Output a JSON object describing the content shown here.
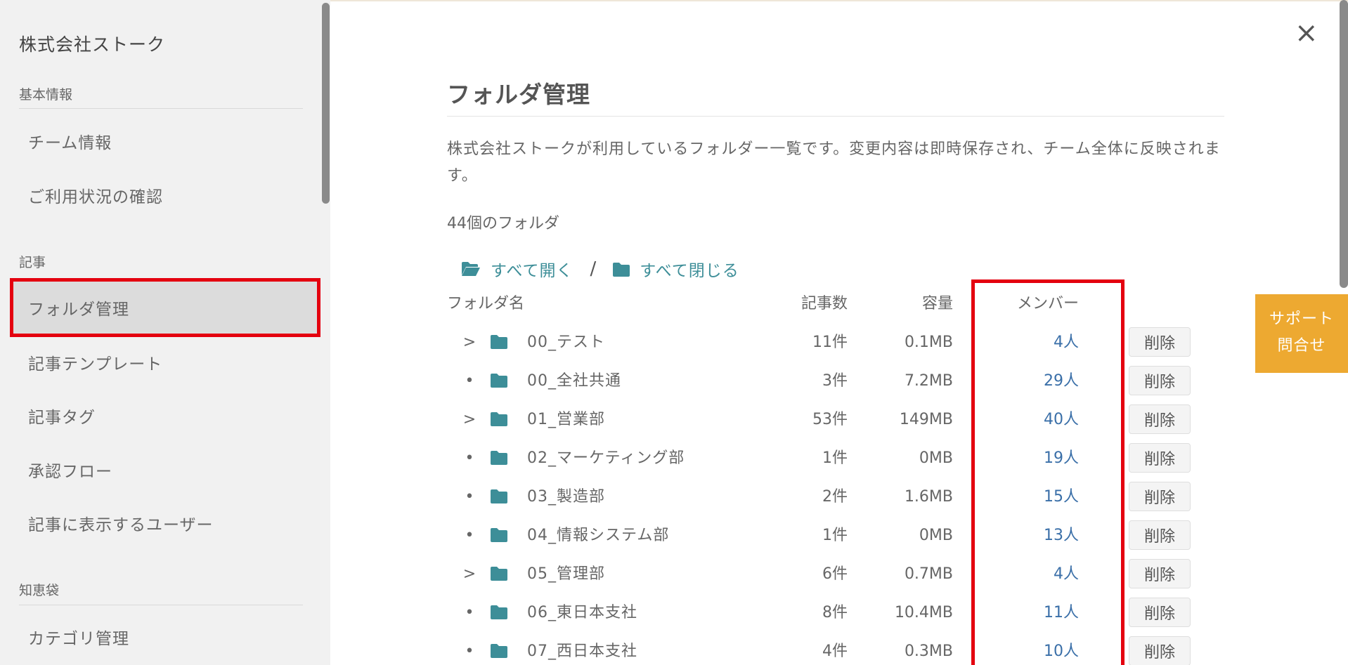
{
  "sidebar": {
    "company": "株式会社ストーク",
    "sections": [
      {
        "label": "基本情報",
        "items": [
          "チーム情報",
          "ご利用状況の確認"
        ]
      },
      {
        "label": "記事",
        "items": [
          "フォルダ管理",
          "記事テンプレート",
          "記事タグ",
          "承認フロー",
          "記事に表示するユーザー"
        ]
      },
      {
        "label": "知恵袋",
        "items": [
          "カテゴリ管理"
        ]
      }
    ],
    "active_item": "フォルダ管理"
  },
  "main": {
    "close_symbol": "×",
    "title": "フォルダ管理",
    "description": "株式会社ストークが利用しているフォルダー一覧です。変更内容は即時保存され、チーム全体に反映されます。",
    "folder_count": "44個のフォルダ",
    "expand_all": "すべて開く",
    "separator": "/",
    "collapse_all": "すべて閉じる",
    "columns": {
      "name": "フォルダ名",
      "articles": "記事数",
      "size": "容量",
      "members": "メンバー"
    },
    "rows": [
      {
        "toggle": ">",
        "name": "00_テスト",
        "articles": "11件",
        "size": "0.1MB",
        "members": "4人",
        "action": "削除"
      },
      {
        "toggle": "•",
        "name": "00_全社共通",
        "articles": "3件",
        "size": "7.2MB",
        "members": "29人",
        "action": "削除"
      },
      {
        "toggle": ">",
        "name": "01_営業部",
        "articles": "53件",
        "size": "149MB",
        "members": "40人",
        "action": "削除"
      },
      {
        "toggle": "•",
        "name": "02_マーケティング部",
        "articles": "1件",
        "size": "0MB",
        "members": "19人",
        "action": "削除"
      },
      {
        "toggle": "•",
        "name": "03_製造部",
        "articles": "2件",
        "size": "1.6MB",
        "members": "15人",
        "action": "削除"
      },
      {
        "toggle": "•",
        "name": "04_情報システム部",
        "articles": "1件",
        "size": "0MB",
        "members": "13人",
        "action": "削除"
      },
      {
        "toggle": ">",
        "name": "05_管理部",
        "articles": "6件",
        "size": "0.7MB",
        "members": "4人",
        "action": "削除"
      },
      {
        "toggle": "•",
        "name": "06_東日本支社",
        "articles": "8件",
        "size": "10.4MB",
        "members": "11人",
        "action": "削除"
      },
      {
        "toggle": "•",
        "name": "07_西日本支社",
        "articles": "4件",
        "size": "0.3MB",
        "members": "10人",
        "action": "削除"
      }
    ]
  },
  "support": {
    "line1": "サポート",
    "line2": "問合せ"
  },
  "colors": {
    "accent_teal": "#3d8e98",
    "member_link": "#3a6fa8",
    "highlight_red": "#e4000f",
    "support_orange": "#eda931"
  }
}
